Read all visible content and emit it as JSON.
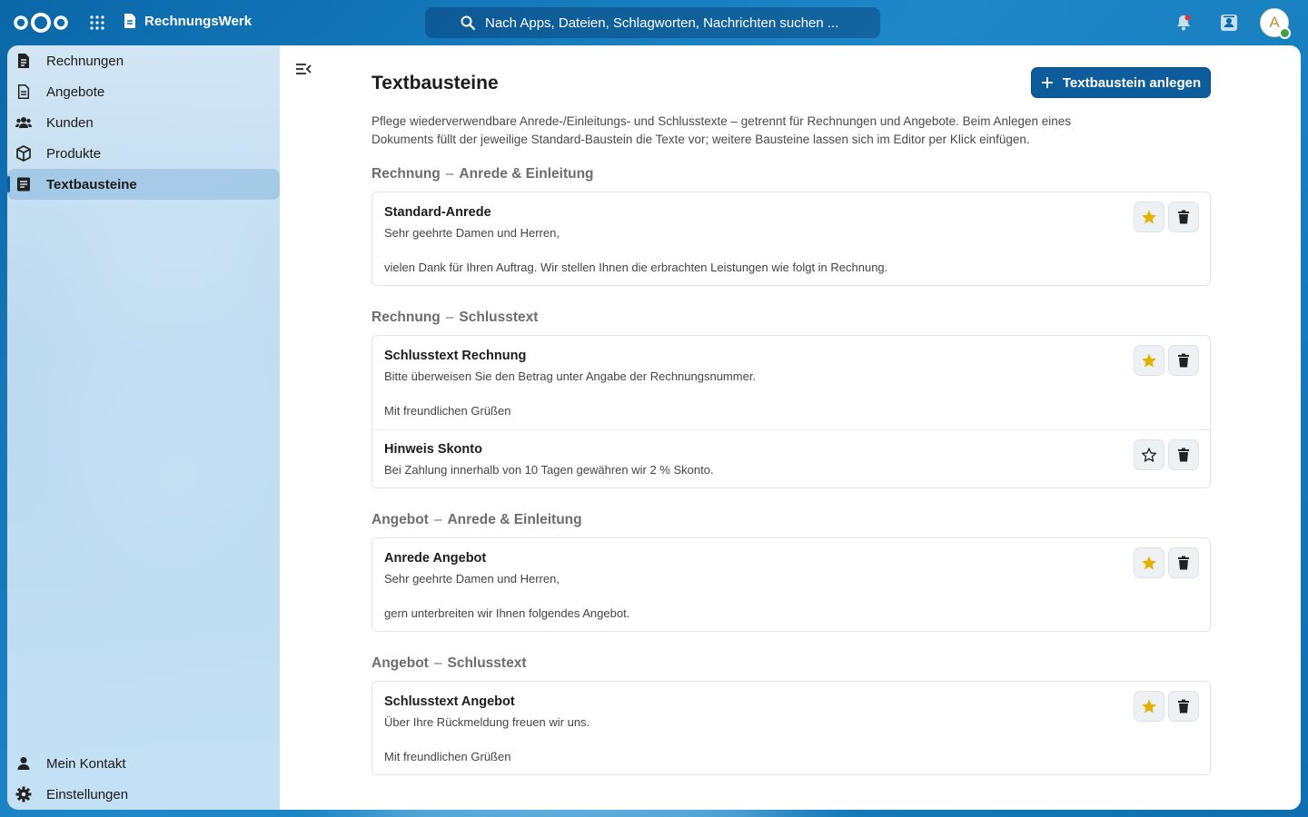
{
  "header": {
    "app_name": "RechnungsWerk",
    "search_placeholder": "Nach Apps, Dateien, Schlagworten, Nachrichten suchen ...",
    "avatar_initial": "A"
  },
  "sidebar": {
    "items": [
      {
        "label": "Rechnungen",
        "icon": "invoice-icon"
      },
      {
        "label": "Angebote",
        "icon": "offer-icon"
      },
      {
        "label": "Kunden",
        "icon": "customers-icon"
      },
      {
        "label": "Produkte",
        "icon": "box-icon"
      },
      {
        "label": "Textbausteine",
        "icon": "text-block-icon",
        "active": true
      }
    ],
    "footer": [
      {
        "label": "Mein Kontakt",
        "icon": "person-icon"
      },
      {
        "label": "Einstellungen",
        "icon": "gear-icon"
      }
    ]
  },
  "main": {
    "title": "Textbausteine",
    "add_button": "Textbaustein anlegen",
    "intro_line1": "Pflege wiederverwendbare Anrede-/Einleitungs- und Schlusstexte – getrennt für Rechnungen und Angebote. Beim Anlegen eines",
    "intro_line2": "Dokuments füllt der jeweilige Standard-Baustein die Texte vor; weitere Bausteine lassen sich im Editor per Klick einfügen.",
    "sections": [
      {
        "doc": "Rechnung",
        "kind": "Anrede & Einleitung",
        "entries": [
          {
            "name": "Standard-Anrede",
            "line1": "Sehr geehrte Damen und Herren,",
            "line2": "vielen Dank für Ihren Auftrag. Wir stellen Ihnen die erbrachten Leistungen wie folgt in Rechnung.",
            "default": true
          }
        ]
      },
      {
        "doc": "Rechnung",
        "kind": "Schlusstext",
        "entries": [
          {
            "name": "Schlusstext Rechnung",
            "line1": "Bitte überweisen Sie den Betrag unter Angabe der Rechnungsnummer.",
            "line2": "Mit freundlichen Grüßen",
            "default": true
          },
          {
            "name": "Hinweis Skonto",
            "line1": "Bei Zahlung innerhalb von 10 Tagen gewähren wir 2 % Skonto.",
            "line2": "",
            "default": false
          }
        ]
      },
      {
        "doc": "Angebot",
        "kind": "Anrede & Einleitung",
        "entries": [
          {
            "name": "Anrede Angebot",
            "line1": "Sehr geehrte Damen und Herren,",
            "line2": "gern unterbreiten wir Ihnen folgendes Angebot.",
            "default": true
          }
        ]
      },
      {
        "doc": "Angebot",
        "kind": "Schlusstext",
        "entries": [
          {
            "name": "Schlusstext Angebot",
            "line1": "Über Ihre Rückmeldung freuen wir uns.",
            "line2": "Mit freundlichen Grüßen",
            "default": true
          }
        ]
      }
    ]
  },
  "colors": {
    "primary": "#0d5d9c",
    "star_filled": "#e6b000",
    "header_bg": "#0a67a8"
  }
}
